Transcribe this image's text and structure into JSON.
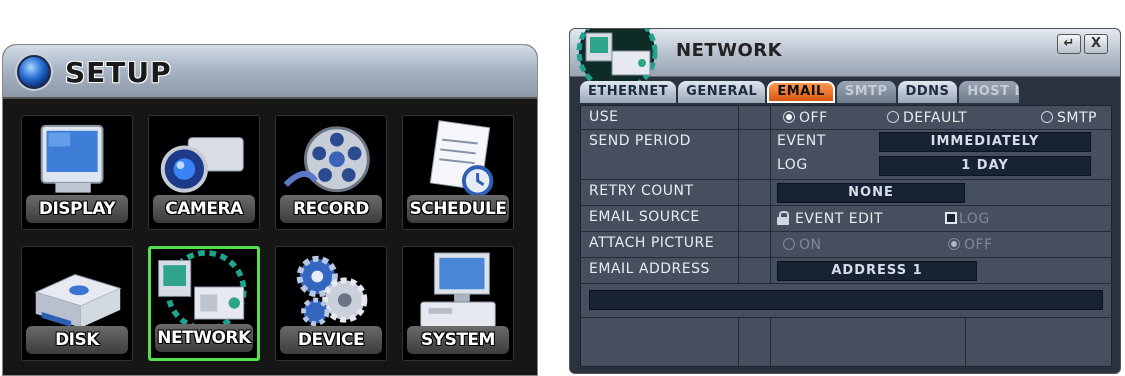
{
  "setup": {
    "title": "SETUP",
    "tiles": [
      {
        "label": "DISPLAY",
        "icon": "monitor-icon"
      },
      {
        "label": "CAMERA",
        "icon": "camera-icon"
      },
      {
        "label": "RECORD",
        "icon": "film-reel-icon"
      },
      {
        "label": "SCHEDULE",
        "icon": "schedule-icon"
      },
      {
        "label": "DISK",
        "icon": "disk-icon"
      },
      {
        "label": "NETWORK",
        "icon": "network-icon",
        "selected": true
      },
      {
        "label": "DEVICE",
        "icon": "gears-icon"
      },
      {
        "label": "SYSTEM",
        "icon": "computer-icon"
      }
    ]
  },
  "network": {
    "title": "NETWORK",
    "buttons": {
      "enter": "↵",
      "close": "X"
    },
    "tabs": [
      {
        "label": "ETHERNET",
        "state": "normal"
      },
      {
        "label": "GENERAL",
        "state": "normal"
      },
      {
        "label": "EMAIL",
        "state": "active"
      },
      {
        "label": "SMTP",
        "state": "disabled"
      },
      {
        "label": "DDNS",
        "state": "normal"
      },
      {
        "label": "HOST L",
        "state": "disabled"
      }
    ],
    "use": {
      "label": "USE",
      "options": [
        "OFF",
        "DEFAULT",
        "SMTP"
      ],
      "selected": "OFF"
    },
    "send_period": {
      "label": "SEND PERIOD",
      "event_label": "EVENT",
      "event_value": "IMMEDIATELY",
      "log_label": "LOG",
      "log_value": "1 DAY"
    },
    "retry_count": {
      "label": "RETRY COUNT",
      "value": "NONE"
    },
    "email_source": {
      "label": "EMAIL SOURCE",
      "event_edit": "EVENT EDIT",
      "log": "LOG"
    },
    "attach_picture": {
      "label": "ATTACH PICTURE",
      "on": "ON",
      "off": "OFF",
      "selected": "OFF"
    },
    "email_address": {
      "label": "EMAIL ADDRESS",
      "value": "ADDRESS 1",
      "address_text": ""
    },
    "colors": {
      "accent": "#e8681e",
      "selected_tile_border": "#55e04a",
      "field_bg": "#172235"
    }
  }
}
